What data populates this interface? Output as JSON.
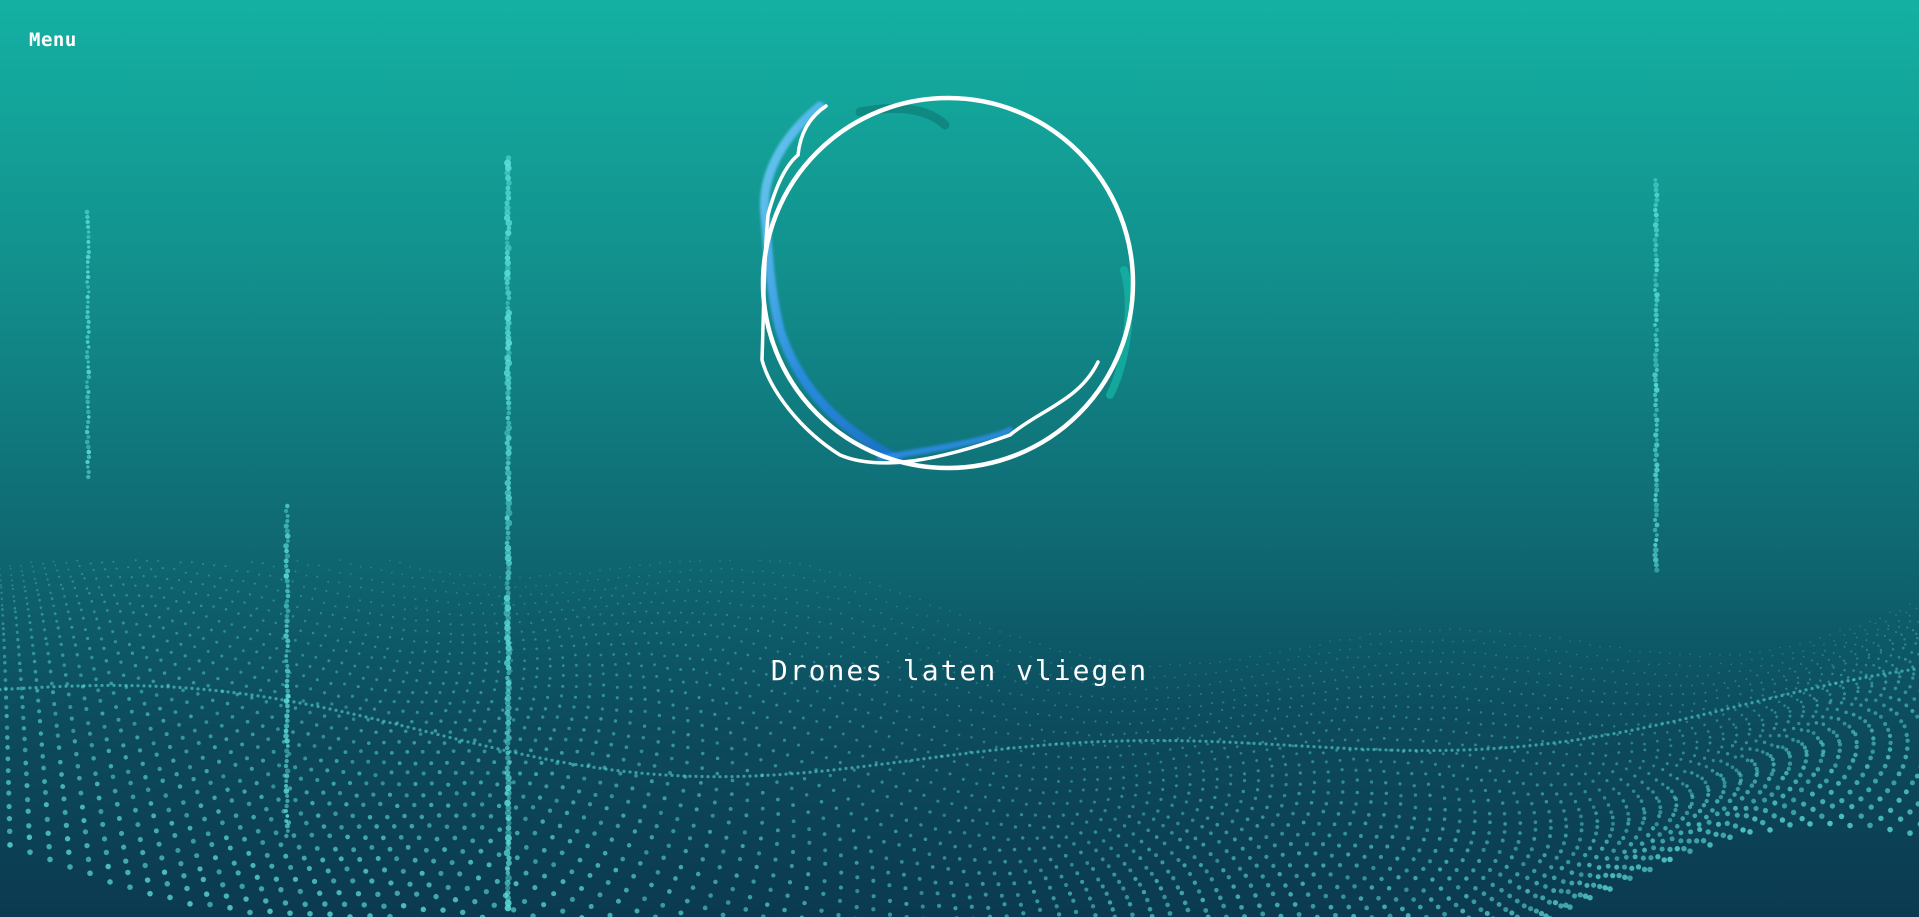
{
  "header": {
    "menu_label": "Menu"
  },
  "hero": {
    "tagline": "Drones laten vliegen"
  },
  "theme": {
    "background_top": "#14b1a3",
    "background_bottom": "#0b3a50",
    "particle_color": "#5fe3df",
    "ring_color": "#ffffff",
    "ribbon_color": "#2f8ff0"
  }
}
